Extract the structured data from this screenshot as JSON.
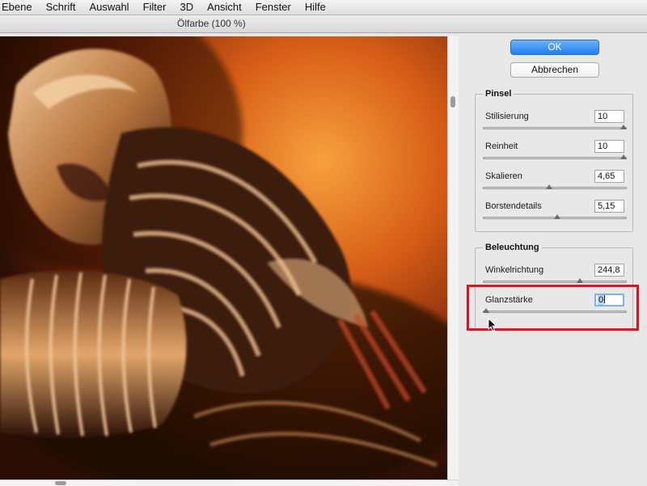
{
  "menu": {
    "items": [
      "Ebene",
      "Schrift",
      "Auswahl",
      "Filter",
      "3D",
      "Ansicht",
      "Fenster",
      "Hilfe"
    ]
  },
  "window": {
    "title": "Ölfarbe (100 %)"
  },
  "buttons": {
    "ok": "OK",
    "cancel": "Abbrechen"
  },
  "pinsel": {
    "title": "Pinsel",
    "params": [
      {
        "label": "Stilisierung",
        "value": "10",
        "slider_fraction": 1.0
      },
      {
        "label": "Reinheit",
        "value": "10",
        "slider_fraction": 1.0
      },
      {
        "label": "Skalieren",
        "value": "4,65",
        "slider_fraction": 0.46
      },
      {
        "label": "Borstendetails",
        "value": "5,15",
        "slider_fraction": 0.515
      }
    ]
  },
  "beleuchtung": {
    "title": "Beleuchtung",
    "params": [
      {
        "label": "Winkelrichtung",
        "value": "244,8",
        "slider_fraction": 0.68
      },
      {
        "label": "Glanzstärke",
        "value": "0",
        "slider_fraction": 0.0
      }
    ]
  },
  "colors": {
    "accent": "#1f7ef1",
    "highlight": "#e4101e"
  },
  "icons": {
    "cursor": "arrow-cursor-icon"
  }
}
